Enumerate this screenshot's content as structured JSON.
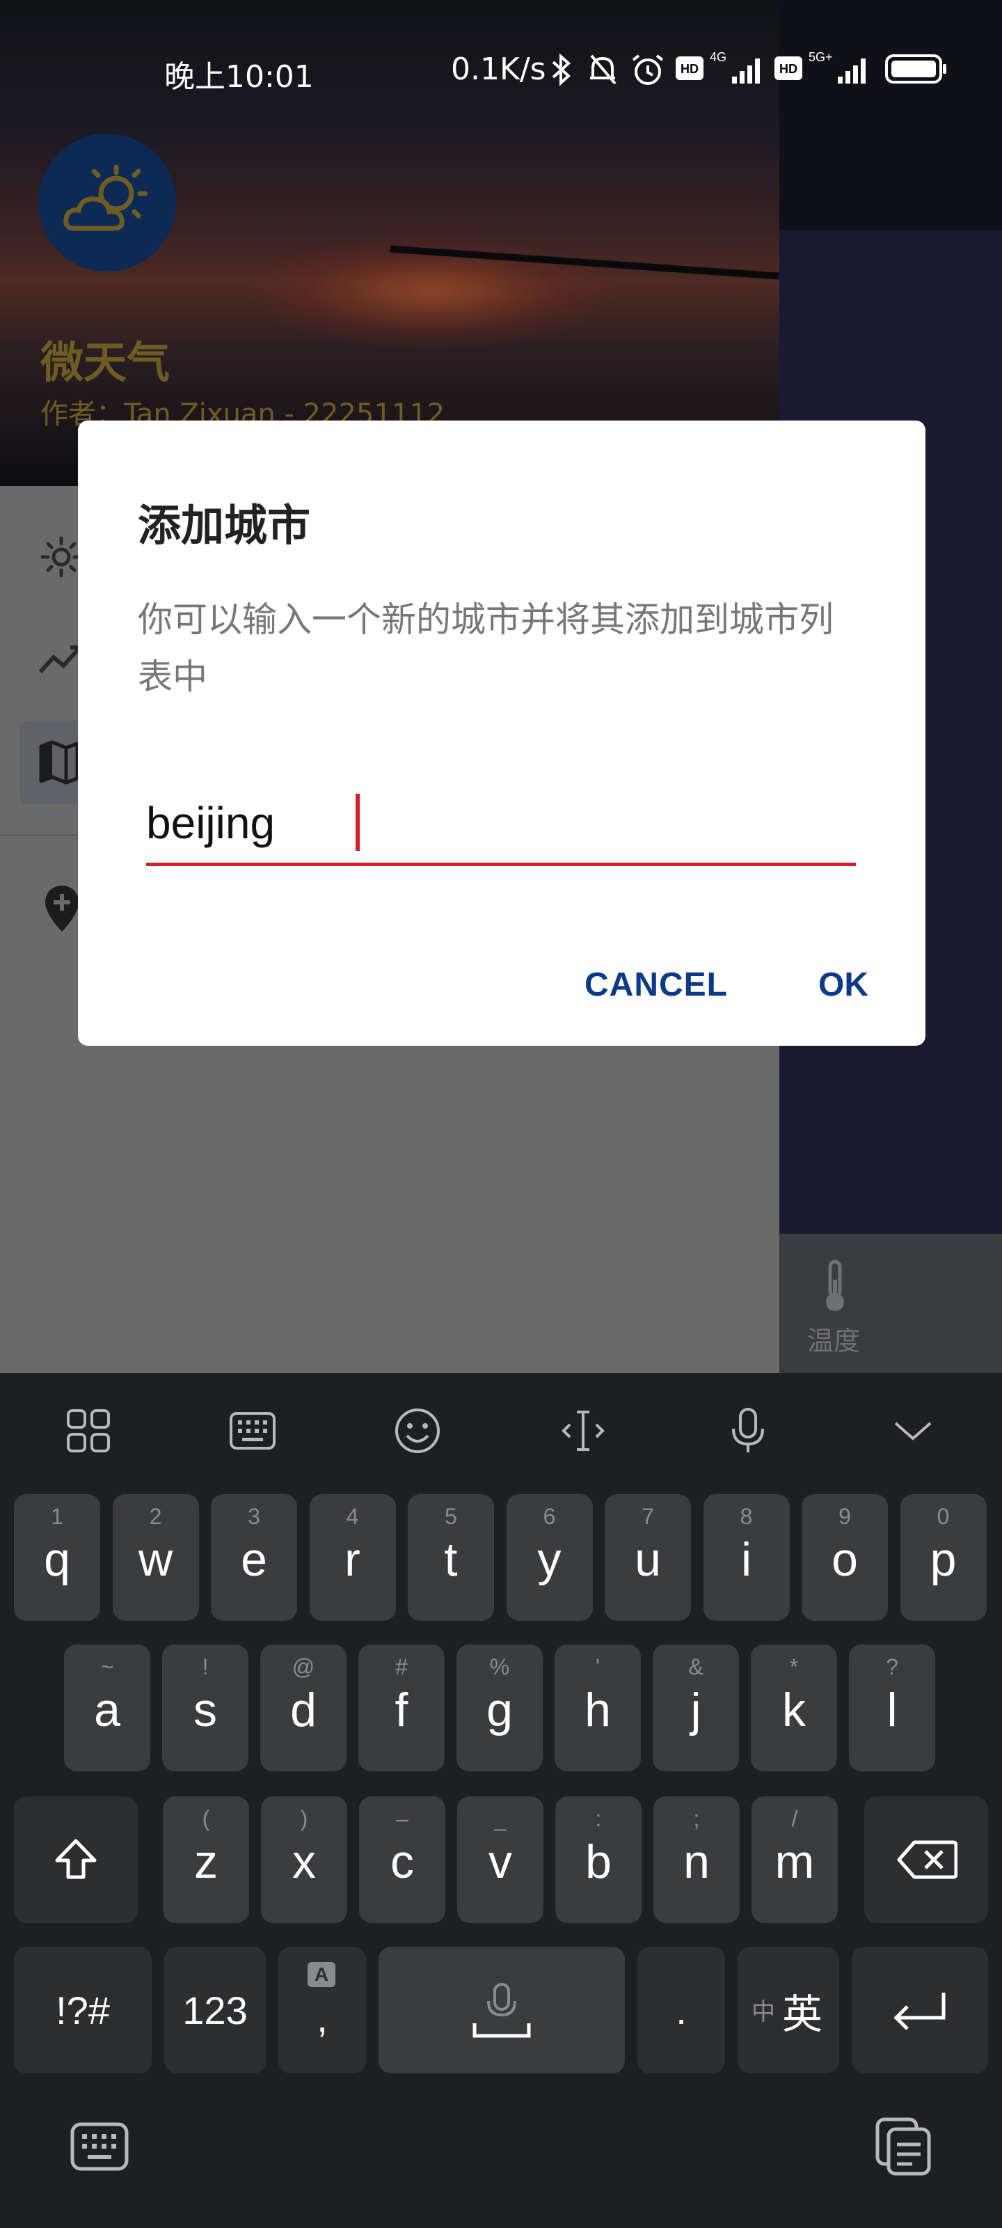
{
  "status_bar": {
    "time": "晚上10:01",
    "network_speed": "0.1K/s",
    "icons": [
      "bluetooth-icon",
      "mute-icon",
      "alarm-icon",
      "hd-icon",
      "signal-4g-icon",
      "hd-icon",
      "signal-5g-icon",
      "battery-icon"
    ],
    "signal_1_label": "4G",
    "signal_2_label": "5G+"
  },
  "drawer": {
    "app_name": "微天气",
    "author": "作者：Tan Zixuan - 22251112",
    "menu_icons": [
      "sun-icon",
      "trend-icon",
      "map-icon",
      "add-location-icon"
    ]
  },
  "bottom_nav": {
    "temperature_label": "温度"
  },
  "dialog": {
    "title": "添加城市",
    "message": "你可以输入一个新的城市并将其添加到城市列表中",
    "input_value": "beijing",
    "cancel_label": "CANCEL",
    "ok_label": "OK"
  },
  "keyboard": {
    "toolbar_icons": [
      "apps-grid-icon",
      "keyboard-icon",
      "emoji-icon",
      "cursor-icon",
      "mic-icon",
      "collapse-icon"
    ],
    "row1": [
      {
        "main": "q",
        "sub": "1"
      },
      {
        "main": "w",
        "sub": "2"
      },
      {
        "main": "e",
        "sub": "3"
      },
      {
        "main": "r",
        "sub": "4"
      },
      {
        "main": "t",
        "sub": "5"
      },
      {
        "main": "y",
        "sub": "6"
      },
      {
        "main": "u",
        "sub": "7"
      },
      {
        "main": "i",
        "sub": "8"
      },
      {
        "main": "o",
        "sub": "9"
      },
      {
        "main": "p",
        "sub": "0"
      }
    ],
    "row2": [
      {
        "main": "a",
        "sub": "~"
      },
      {
        "main": "s",
        "sub": "!"
      },
      {
        "main": "d",
        "sub": "@"
      },
      {
        "main": "f",
        "sub": "#"
      },
      {
        "main": "g",
        "sub": "%"
      },
      {
        "main": "h",
        "sub": "'"
      },
      {
        "main": "j",
        "sub": "&"
      },
      {
        "main": "k",
        "sub": "*"
      },
      {
        "main": "l",
        "sub": "?"
      }
    ],
    "row3": [
      {
        "main": "z",
        "sub": "("
      },
      {
        "main": "x",
        "sub": ")"
      },
      {
        "main": "c",
        "sub": "–"
      },
      {
        "main": "v",
        "sub": "_"
      },
      {
        "main": "b",
        "sub": ":"
      },
      {
        "main": "n",
        "sub": ";"
      },
      {
        "main": "m",
        "sub": "/"
      }
    ],
    "symbols_label": "!?#",
    "numbers_label": "123",
    "comma_label": ",",
    "comma_sub": "A",
    "period_label": ".",
    "lang_small": "中",
    "lang_big": "英"
  }
}
